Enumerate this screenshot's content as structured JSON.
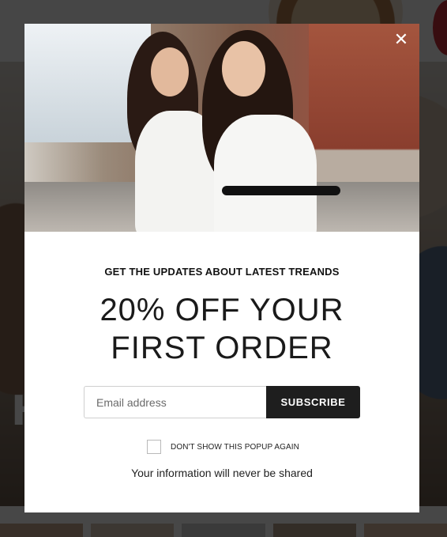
{
  "background": {
    "hero_text": "H"
  },
  "popup": {
    "close_glyph": "✕",
    "subtitle": "GET THE UPDATES ABOUT LATEST TREANDS",
    "headline_line1": "20% OFF YOUR",
    "headline_line2": "FIRST ORDER",
    "email_placeholder": "Email address",
    "email_value": "",
    "subscribe_label": "SUBSCRIBE",
    "checkbox_label": "DON'T SHOW THIS POPUP AGAIN",
    "checkbox_checked": false,
    "privacy_note": "Your information will never be shared"
  },
  "colors": {
    "overlay": "#000000",
    "button_bg": "#1e1e1e",
    "button_text": "#ffffff"
  }
}
